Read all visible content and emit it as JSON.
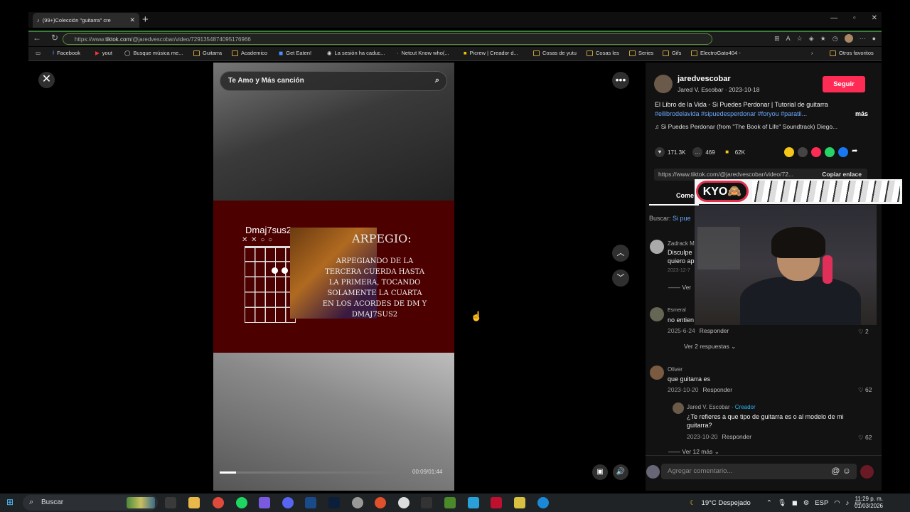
{
  "browser": {
    "tab_title": "(99+)Colección \"guitarra\" cre",
    "url_prefix": "https://www.",
    "url_domain": "tiktok.com",
    "url_path": "/@jaredvescobar/video/7291354874095176966"
  },
  "bookmarks": [
    "Facebook",
    "yout",
    "Busque música me...",
    "Guitarra",
    "Academico",
    "Get Eaten!",
    "La sesión ha caduc...",
    "Netcut Know who(...",
    "Picrew | Creador d...",
    "Cosas de yutu",
    "Cosas les",
    "Series",
    "Gifs",
    "ElectroGato404 -",
    "Otros favoritos"
  ],
  "video": {
    "search_text": "Te Amo y Más canción",
    "chord_name": "Dmaj7sus2",
    "chord_markers": "✕ ✕ ○     ○",
    "arpegio_title": "ARPEGIO:",
    "arpegio_text": "ARPEGIANDO DE LA TERCERA CUERDA HASTA LA PRIMERA, TOCANDO SOLAMENTE LA CUARTA EN LOS ACORDES DE DM Y DMAJ7SUS2",
    "time": "00:09/01:44",
    "progress": 0.09
  },
  "sidebar": {
    "author": "jaredvescobar",
    "subtitle": "Jared V. Escobar · 2023-10-18",
    "follow_label": "Seguir",
    "description": "El Libro de la Vida - Si Puedes Perdonar | Tutorial de guitarra",
    "hashtags": "#ellibrodelavida #sipuedesperdonar #foryou #paratii...",
    "more_label": "más",
    "music": "♫  Si Puedes Perdonar (from \"The Book of Life\" Soundtrack)   Diego...",
    "likes": "171.3K",
    "comments_count": "469",
    "saves": "62K",
    "link": "https://www.tiktok.com/@jaredvescobar/video/72...",
    "copy_link_label": "Copiar enlace",
    "tab_comments": "Come",
    "search_label": "Buscar:",
    "search_term": "Si pue",
    "comments": [
      {
        "user": "Zadrack M",
        "text": "Disculpe\nquiero ap",
        "date": "2023-12-7",
        "reply": "",
        "likes": "",
        "more": "Ver"
      },
      {
        "user": "Esmeral",
        "text": "no entien",
        "date": "2025-6-24",
        "reply": "Responder",
        "likes": "♡ 2",
        "more": "Ver 2 respuestas ⌄"
      },
      {
        "user": "Oliver",
        "text": "que guitarra es",
        "date": "2023-10-20",
        "reply": "Responder",
        "likes": "♡ 62",
        "more": ""
      }
    ],
    "reply": {
      "user": "Jared V. Escobar",
      "badge": "Creador",
      "text": "¿Te refieres a que tipo de guitarra es o al modelo de mi guitarra?",
      "date": "2023-10-20",
      "reply": "Responder",
      "likes": "♡ 62",
      "more": "Ver 12 más ⌄"
    },
    "add_comment_placeholder": "Agregar comentario..."
  },
  "overlay": {
    "streamer_name": "KYO🙈"
  },
  "taskbar": {
    "search_label": "Buscar",
    "weather": "19°C  Despejado",
    "lang": "ESP",
    "time": "11:29 p. m.",
    "date": "01/03/2026"
  }
}
